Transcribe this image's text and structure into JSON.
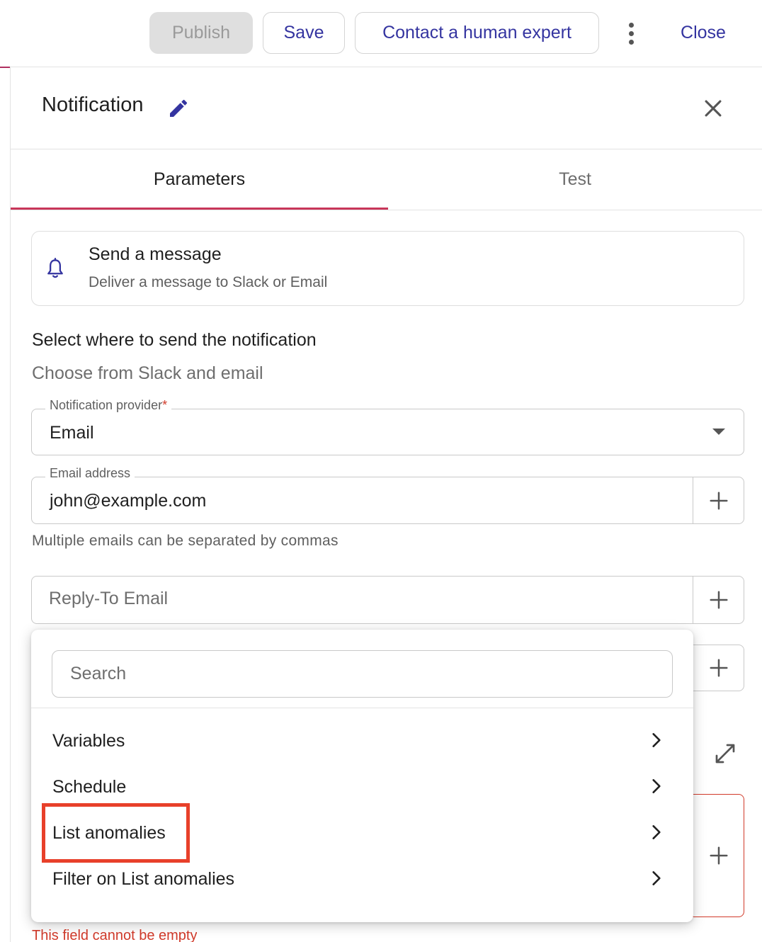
{
  "toolbar": {
    "publish_label": "Publish",
    "save_label": "Save",
    "contact_label": "Contact a human expert",
    "close_label": "Close"
  },
  "panel": {
    "title": "Notification",
    "tabs": [
      {
        "label": "Parameters",
        "active": true
      },
      {
        "label": "Test",
        "active": false
      }
    ]
  },
  "action_card": {
    "title": "Send a message",
    "subtitle": "Deliver a message to Slack or Email",
    "icon": "bell-icon"
  },
  "section": {
    "title": "Select where to send the notification",
    "subtitle": "Choose from Slack and email"
  },
  "fields": {
    "provider": {
      "label": "Notification provider",
      "required_mark": "*",
      "value": "Email"
    },
    "email": {
      "label": "Email address",
      "value": "john@example.com",
      "helper": "Multiple emails can be separated by commas"
    },
    "reply_to": {
      "placeholder": "Reply-To Email"
    },
    "error_text": "This field cannot be empty"
  },
  "popup": {
    "search_placeholder": "Search",
    "items": [
      {
        "label": "Variables"
      },
      {
        "label": "Schedule"
      },
      {
        "label": "List anomalies",
        "highlighted": true
      },
      {
        "label": "Filter on List anomalies"
      }
    ]
  },
  "colors": {
    "accent": "#3434a0",
    "tab_underline": "#c8365a",
    "highlight": "#e8402a",
    "error": "#d13a2a"
  }
}
